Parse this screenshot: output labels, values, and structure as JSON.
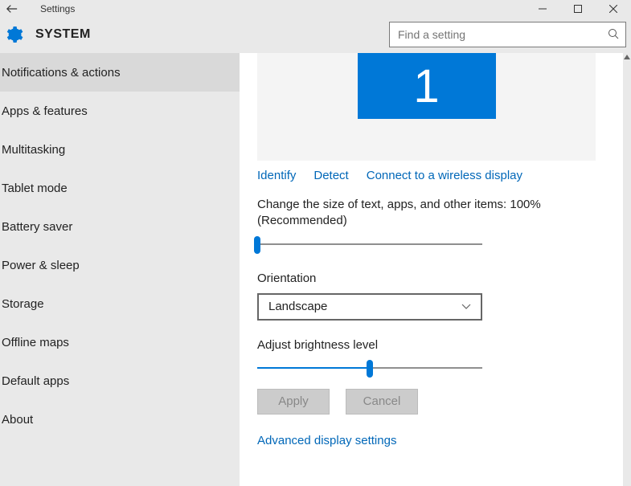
{
  "titlebar": {
    "title": "Settings"
  },
  "header": {
    "title": "SYSTEM"
  },
  "search": {
    "placeholder": "Find a setting"
  },
  "sidebar": {
    "items": [
      {
        "label": "Notifications & actions",
        "active": true
      },
      {
        "label": "Apps & features"
      },
      {
        "label": "Multitasking"
      },
      {
        "label": "Tablet mode"
      },
      {
        "label": "Battery saver"
      },
      {
        "label": "Power & sleep"
      },
      {
        "label": "Storage"
      },
      {
        "label": "Offline maps"
      },
      {
        "label": "Default apps"
      },
      {
        "label": "About"
      }
    ]
  },
  "display": {
    "monitor_number": "1",
    "links": {
      "identify": "Identify",
      "detect": "Detect",
      "wireless": "Connect to a wireless display"
    },
    "scale_label": "Change the size of text, apps, and other items: 100% (Recommended)",
    "scale_percent": 0,
    "orientation_label": "Orientation",
    "orientation_value": "Landscape",
    "brightness_label": "Adjust brightness level",
    "brightness_percent": 50,
    "apply_label": "Apply",
    "cancel_label": "Cancel",
    "advanced_link": "Advanced display settings"
  }
}
